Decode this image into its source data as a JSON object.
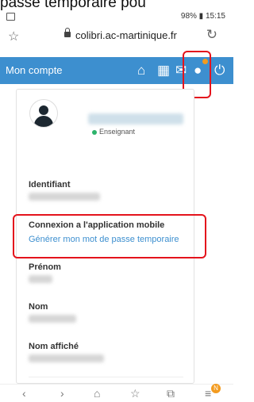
{
  "caption": "passe temporaire pou",
  "status": {
    "right": "98% ▮ 15:15"
  },
  "browser": {
    "url": "colibri.ac-martinique.fr"
  },
  "appbar": {
    "title": "Mon compte"
  },
  "profile": {
    "role": "Enseignant",
    "role_color": "#2db36b",
    "fields": [
      {
        "label": "Identifiant"
      },
      {
        "label": "Connexion a l'application mobile",
        "link": "Générer mon mot de passe temporaire"
      },
      {
        "label": "Prénom"
      },
      {
        "label": "Nom"
      },
      {
        "label": "Nom affiché"
      }
    ]
  },
  "colors": {
    "accent": "#3d8fcf",
    "highlight": "#e4131c",
    "notification": "#f39b1f"
  },
  "icons": [
    "home-icon",
    "grid-icon",
    "mail-icon",
    "user-icon",
    "power-icon",
    "star-icon",
    "lock-icon",
    "reload-icon",
    "back-icon",
    "forward-icon",
    "home-nav-icon",
    "bookmarks-icon",
    "tabs-icon",
    "menu-icon"
  ],
  "nav_badge": "N"
}
